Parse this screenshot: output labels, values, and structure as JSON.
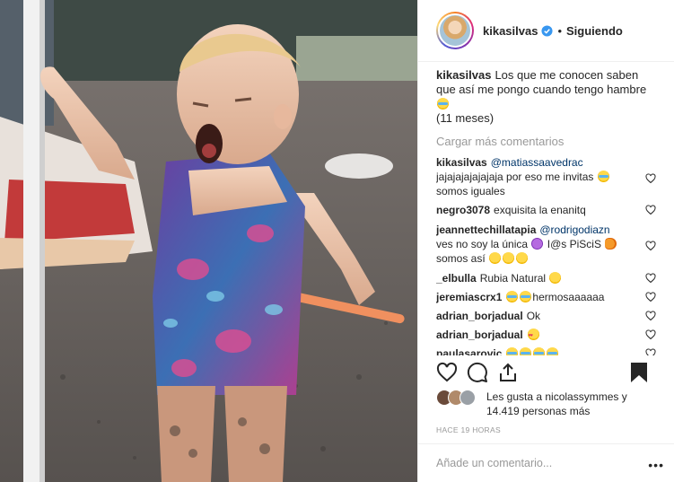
{
  "header": {
    "username": "kikasilvas",
    "verified": true,
    "separator": "•",
    "follow_status": "Siguiendo"
  },
  "caption": {
    "username": "kikasilvas",
    "text_before_emoji": "Los que me conocen saben que así me pongo cuando tengo hambre",
    "emoji": "crying-laughing-face",
    "text_after_emoji": "(11 meses)"
  },
  "load_more": "Cargar más comentarios",
  "comments": [
    {
      "username": "kikasilvas",
      "mention": "@matiassaavedrac",
      "text": "jajajajajajajaja por eso me invitas",
      "emoji_mid": "crying-laughing-face",
      "text_after": "somos iguales"
    },
    {
      "username": "negro3078",
      "text": "exquisita la enanitq"
    },
    {
      "username": "jeannettechillatapia",
      "mention": "@rodrigodiazn",
      "text": "ves no soy la única",
      "emoji_mid": "purple-face",
      "text_after": "I@s PiSciS",
      "emoji_end": "fish",
      "text_line3": "somos así"
    },
    {
      "username": "_elbulla",
      "text": "Rubia Natural",
      "emoji_end": "smiling-face"
    },
    {
      "username": "jeremiascrx1",
      "text": "hermosaaaaaa",
      "emoji_start": "crying-laughing-face"
    },
    {
      "username": "adrian_borjadual",
      "text": "Ok"
    },
    {
      "username": "adrian_borjadual",
      "text": "",
      "emoji_end": "heart-eyes-face"
    },
    {
      "username": "paulasarovic",
      "text": "",
      "emoji_end": "rolling-laughing-face"
    }
  ],
  "actions": {
    "like_icon": "heart-icon",
    "comment_icon": "comment-icon",
    "share_icon": "share-icon",
    "save_icon": "bookmark-icon"
  },
  "likes": {
    "line1": "Les gusta a nicolassymmes y",
    "line2": "14.419 personas más"
  },
  "timestamp": "HACE 19 HORAS",
  "add_comment": {
    "placeholder": "Añade un comentario...",
    "more_icon": "ellipsis-icon"
  },
  "colors": {
    "mention": "#003569",
    "muted": "#999999",
    "text": "#262626",
    "verified": "#3897f0"
  }
}
